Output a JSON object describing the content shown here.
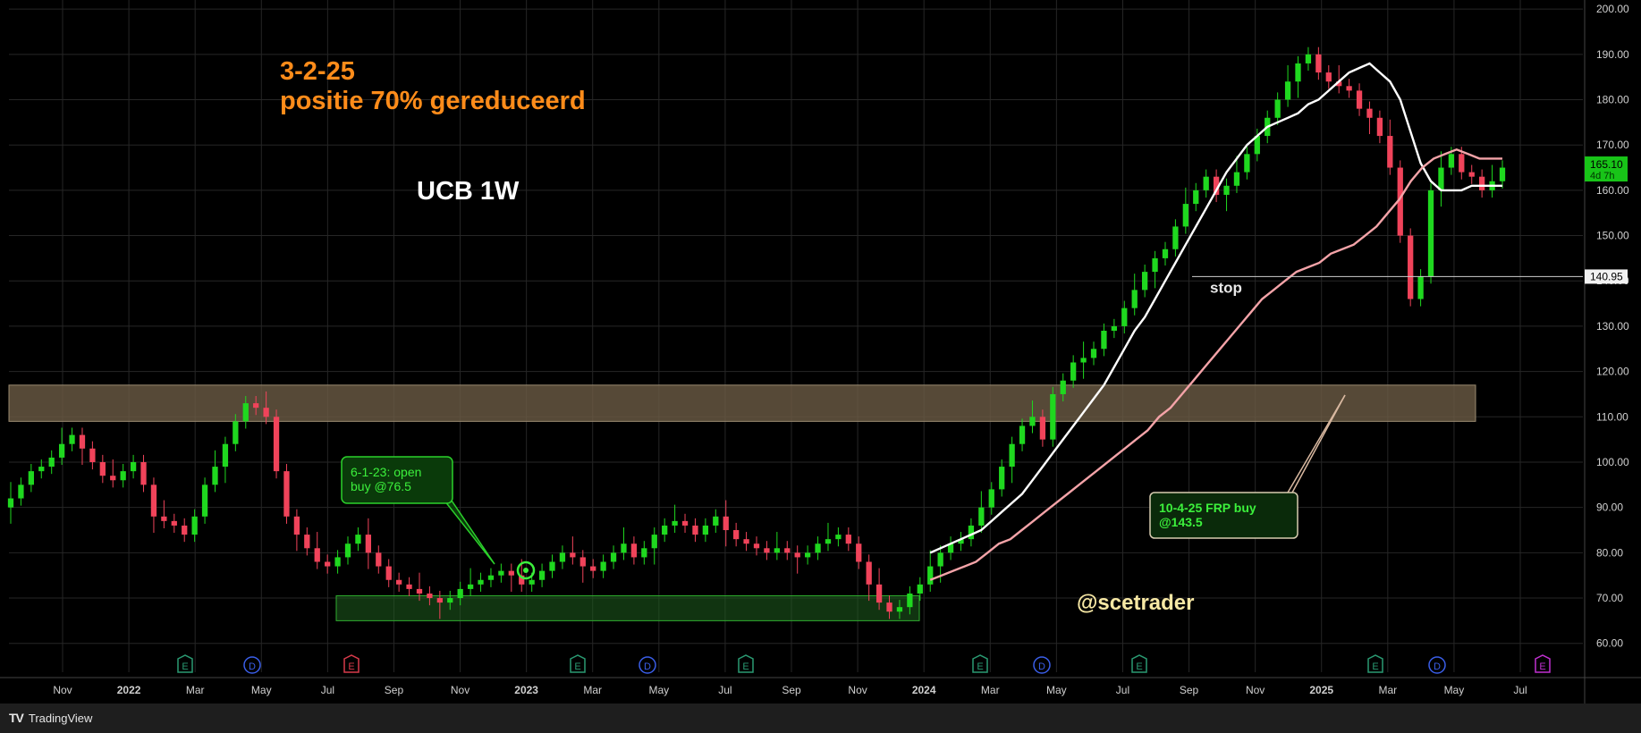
{
  "chart_data": {
    "type": "candlestick",
    "symbol_label": "UCB 1W",
    "note_date": "3-2-25",
    "note_text": "positie 70% gereduceerd",
    "watermark": "@scetrader",
    "ylim": [
      56,
      202
    ],
    "y_ticks": [
      "200.00",
      "190.00",
      "180.00",
      "170.00",
      "160.00",
      "150.00",
      "140.00",
      "130.00",
      "120.00",
      "110.00",
      "100.00",
      "90.00",
      "80.00",
      "70.00",
      "60.00"
    ],
    "x_ticks": [
      "Nov",
      "2022",
      "Mar",
      "May",
      "Jul",
      "Sep",
      "Nov",
      "2023",
      "Mar",
      "May",
      "Jul",
      "Sep",
      "Nov",
      "2024",
      "Mar",
      "May",
      "Jul",
      "Sep",
      "Nov",
      "2025",
      "Mar",
      "May",
      "Jul"
    ],
    "last_price": "165.10",
    "countdown": "4d 7h",
    "stop_price": "140.95",
    "stop_label": "stop",
    "annotation_buy": "6-1-23: open buy @76.5",
    "annotation_frp": "10-4-25 FRP buy @143.5",
    "resistance_zone": [
      109,
      117
    ],
    "support_zone": [
      65,
      70.5
    ],
    "event_markers": [
      "E",
      "D",
      "E",
      "E",
      "D",
      "E",
      "E",
      "D",
      "E",
      "E",
      "D",
      "E"
    ],
    "candles_close": [
      92,
      95,
      98,
      99,
      101,
      104,
      106,
      103,
      100,
      97,
      96,
      98,
      100,
      95,
      88,
      87,
      86,
      84,
      88,
      95,
      99,
      104,
      109,
      113,
      112,
      110,
      98,
      88,
      84,
      81,
      78,
      77,
      79,
      82,
      84,
      80,
      77,
      74,
      73,
      72,
      71,
      70,
      69,
      70,
      72,
      73,
      74,
      75,
      76,
      75,
      73,
      74,
      76,
      78,
      80,
      79,
      77,
      76,
      78,
      80,
      82,
      79,
      81,
      84,
      86,
      87,
      86,
      84,
      86,
      88,
      85,
      83,
      82,
      81,
      80,
      81,
      80,
      79,
      80,
      82,
      83,
      84,
      82,
      78,
      73,
      69,
      67,
      68,
      71,
      73,
      77,
      80,
      82,
      83,
      86,
      90,
      94,
      99,
      104,
      108,
      110,
      105,
      115,
      118,
      122,
      123,
      125,
      129,
      130,
      134,
      138,
      142,
      145,
      147,
      152,
      157,
      160,
      163,
      159,
      161,
      164,
      168,
      172,
      176,
      180,
      184,
      188,
      190,
      186,
      184,
      183,
      182,
      178,
      176,
      172,
      165,
      150,
      136,
      141,
      160,
      165,
      168,
      164,
      163,
      160,
      162,
      165
    ],
    "ma_fast": [
      80,
      81,
      82,
      83,
      84,
      85,
      87,
      89,
      91,
      93,
      96,
      99,
      102,
      105,
      108,
      111,
      114,
      117,
      121,
      125,
      129,
      132,
      136,
      140,
      144,
      148,
      152,
      156,
      160,
      164,
      167,
      170,
      172,
      174,
      175,
      176,
      177,
      179,
      180,
      182,
      184,
      186,
      187,
      188,
      186,
      184,
      180,
      173,
      166,
      162,
      160,
      160,
      160,
      161,
      161,
      161,
      161
    ],
    "ma_slow": [
      74,
      75,
      76,
      77,
      78,
      80,
      82,
      83,
      85,
      87,
      89,
      91,
      93,
      95,
      97,
      99,
      101,
      103,
      105,
      107,
      110,
      112,
      115,
      118,
      121,
      124,
      127,
      130,
      133,
      136,
      138,
      140,
      142,
      143,
      144,
      146,
      147,
      148,
      150,
      152,
      155,
      158,
      162,
      165,
      167,
      168,
      169,
      168,
      167,
      167,
      167
    ]
  }
}
